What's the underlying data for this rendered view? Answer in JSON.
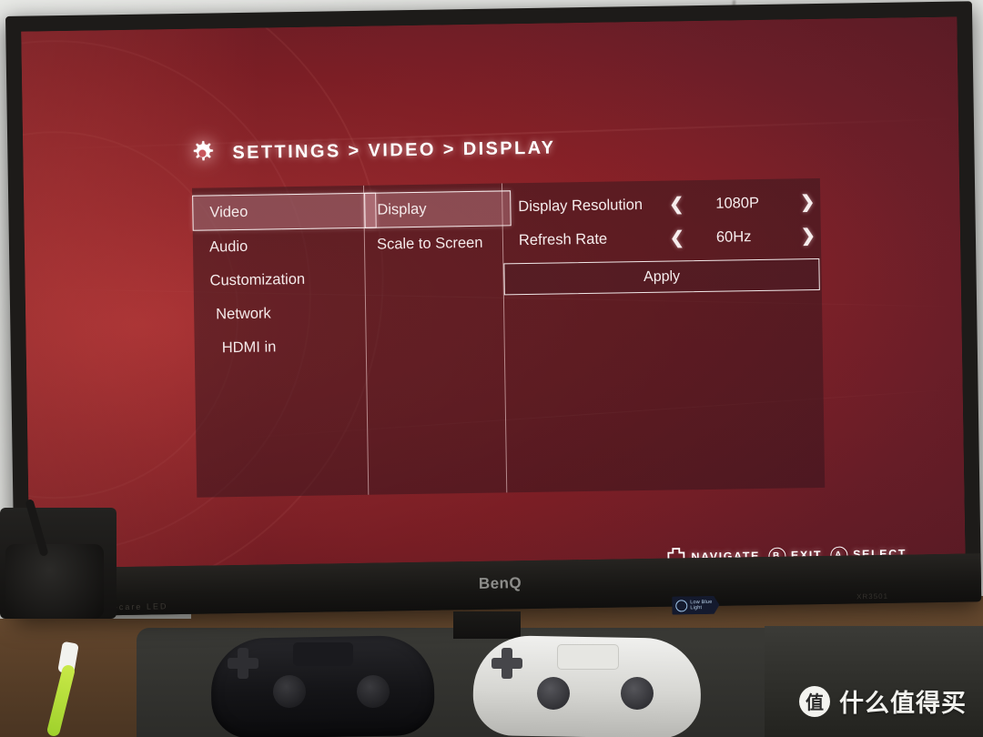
{
  "osd": {
    "breadcrumb": "SETTINGS > VIDEO > DISPLAY",
    "gear_icon": "gear-icon",
    "menu_column_1": [
      {
        "label": "Video",
        "selected": true
      },
      {
        "label": "Audio",
        "selected": false
      },
      {
        "label": "Customization",
        "selected": false
      },
      {
        "label": "Network",
        "selected": false
      },
      {
        "label": "HDMI in",
        "selected": false
      }
    ],
    "menu_column_2": [
      {
        "label": "Display",
        "selected": true
      },
      {
        "label": "Scale to Screen",
        "selected": false
      }
    ],
    "options": [
      {
        "name": "Display Resolution",
        "value": "1080P",
        "left_arrow": "❮",
        "right_arrow": "❯"
      },
      {
        "name": "Refresh Rate",
        "value": "60Hz",
        "left_arrow": "❮",
        "right_arrow": "❯"
      }
    ],
    "apply_label": "Apply",
    "hints": [
      {
        "icon": "dpad-icon",
        "label": "NAVIGATE"
      },
      {
        "icon": "button-b-icon",
        "glyph": "B",
        "label": "EXIT"
      },
      {
        "icon": "button-a-icon",
        "glyph": "A",
        "label": "SELECT"
      }
    ],
    "colors": {
      "screen_red": "#a82e31",
      "panel_overlay": "#3c181e",
      "selection_fill": "#e8aab4",
      "selection_border": "#fffafa",
      "text": "#f4eaea"
    }
  },
  "monitor": {
    "brand": "BenQ",
    "bezel_left_text": "MHL   eye-care   LED",
    "model_text": "XR3501",
    "low_blue_light_badge": {
      "label_line1": "Low Blue",
      "label_line2": "Light",
      "icon": "lightbulb-icon"
    }
  },
  "watermark": {
    "logo_glyph": "值",
    "text": "什么值得买"
  }
}
